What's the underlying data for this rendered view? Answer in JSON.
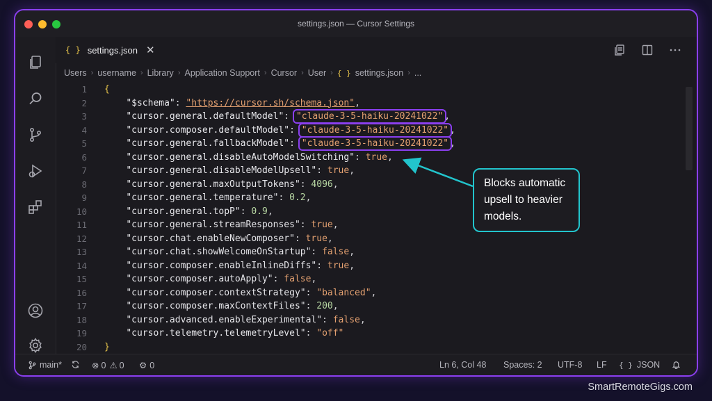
{
  "window": {
    "title": "settings.json — Cursor Settings"
  },
  "tab": {
    "icon": "braces-icon",
    "label": "settings.json",
    "close": "✕"
  },
  "breadcrumb": [
    "Users",
    "username",
    "Library",
    "Application Support",
    "Cursor",
    "User",
    "settings.json",
    "..."
  ],
  "lines": [
    {
      "n": "1"
    },
    {
      "n": "2"
    },
    {
      "n": "3"
    },
    {
      "n": "4"
    },
    {
      "n": "5"
    },
    {
      "n": "6"
    },
    {
      "n": "7"
    },
    {
      "n": "8"
    },
    {
      "n": "9"
    },
    {
      "n": "10"
    },
    {
      "n": "11"
    },
    {
      "n": "12"
    },
    {
      "n": "13"
    },
    {
      "n": "14"
    },
    {
      "n": "15"
    },
    {
      "n": "16"
    },
    {
      "n": "17"
    },
    {
      "n": "18"
    },
    {
      "n": "19"
    },
    {
      "n": "20"
    }
  ],
  "code": {
    "open": "{",
    "close": "}",
    "schema_key": "\"$schema\"",
    "schema_val": "\"https://cursor.sh/schema.json\"",
    "k3": "\"cursor.general.defaultModel\"",
    "v3": "\"claude-3-5-haiku-20241022\"",
    "k4": "\"cursor.composer.defaultModel\"",
    "v4": "\"claude-3-5-haiku-20241022\"",
    "k5": "\"cursor.general.fallbackModel\"",
    "v5": "\"claude-3-5-haiku-20241022\"",
    "k6": "\"cursor.general.disableAutoModelSwitching\"",
    "v6": "true",
    "k7": "\"cursor.general.disableModelUpsell\"",
    "v7": "true",
    "k8": "\"cursor.general.maxOutputTokens\"",
    "v8": "4096",
    "k9": "\"cursor.general.temperature\"",
    "v9": "0.2",
    "k10": "\"cursor.general.topP\"",
    "v10": "0.9",
    "k11": "\"cursor.general.streamResponses\"",
    "v11": "true",
    "k12": "\"cursor.chat.enableNewComposer\"",
    "v12": "true",
    "k13": "\"cursor.chat.showWelcomeOnStartup\"",
    "v13": "false",
    "k14": "\"cursor.composer.enableInlineDiffs\"",
    "v14": "true",
    "k15": "\"cursor.composer.autoApply\"",
    "v15": "false",
    "k16": "\"cursor.composer.contextStrategy\"",
    "v16": "\"balanced\"",
    "k17": "\"cursor.composer.maxContextFiles\"",
    "v17": "200",
    "k18": "\"cursor.advanced.enableExperimental\"",
    "v18": "false",
    "k19": "\"cursor.telemetry.telemetryLevel\"",
    "v19": "\"off\""
  },
  "callout": {
    "text": "Blocks automatic upsell to heavier models."
  },
  "status": {
    "branch": "main*",
    "errors": "0",
    "warnings": "0",
    "ports": "0",
    "position": "Ln 6, Col 48",
    "spaces": "Spaces: 2",
    "encoding": "UTF-8",
    "eol": "LF",
    "language": "JSON"
  },
  "brand": "SmartRemoteGigs.com",
  "colors": {
    "accent": "#8b3ff0",
    "callout": "#22c4cc",
    "string": "#e3a070",
    "number": "#b8d7a3"
  }
}
